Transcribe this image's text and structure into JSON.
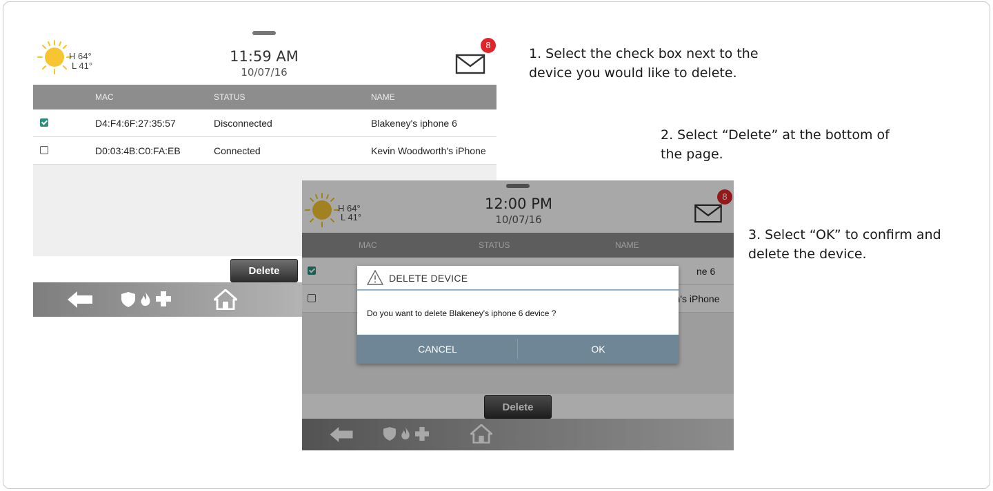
{
  "panel1": {
    "weather": {
      "high": "H 64°",
      "low": "L 41°"
    },
    "time": "11:59 AM",
    "date": "10/07/16",
    "mail_badge": "8",
    "table": {
      "headers": [
        "MAC",
        "STATUS",
        "NAME"
      ],
      "rows": [
        {
          "checked": true,
          "mac": "D4:F4:6F:27:35:57",
          "status": "Disconnected",
          "name": "Blakeney's iphone 6"
        },
        {
          "checked": false,
          "mac": "D0:03:4B:C0:FA:EB",
          "status": "Connected",
          "name": "Kevin Woodworth's iPhone"
        }
      ]
    },
    "delete_label": "Delete"
  },
  "panel2": {
    "weather": {
      "high": "H 64°",
      "low": "L 41°"
    },
    "time": "12:00 PM",
    "date": "10/07/16",
    "mail_badge": "8",
    "table": {
      "headers": [
        "MAC",
        "STATUS",
        "NAME"
      ],
      "row1_name_fragment": "ne 6",
      "row2_name_fragment": "rth's iPhone"
    },
    "dialog": {
      "title": "DELETE DEVICE",
      "message": "Do you want to delete Blakeney's iphone 6 device ?",
      "cancel_label": "CANCEL",
      "ok_label": "OK"
    },
    "delete_label": "Delete"
  },
  "instructions": {
    "step1_line1": "1. Select the check box next to the",
    "step1_line2": "device you would like to delete.",
    "step2_line1": "2. Select “Delete” at the bottom of",
    "step2_line2": "the page.",
    "step3_line1": "3. Select “OK” to confirm and",
    "step3_line2": "delete the device."
  },
  "icons": [
    "sun-icon",
    "mail-icon",
    "back-arrow-icon",
    "shield-icon",
    "fire-icon",
    "medical-cross-icon",
    "home-icon",
    "warning-icon"
  ],
  "colors": {
    "badge": "#e0252a",
    "checkbox": "#2a8f7e",
    "dialog_buttons": "#6f8696",
    "table_header": "#8d8d8d"
  }
}
